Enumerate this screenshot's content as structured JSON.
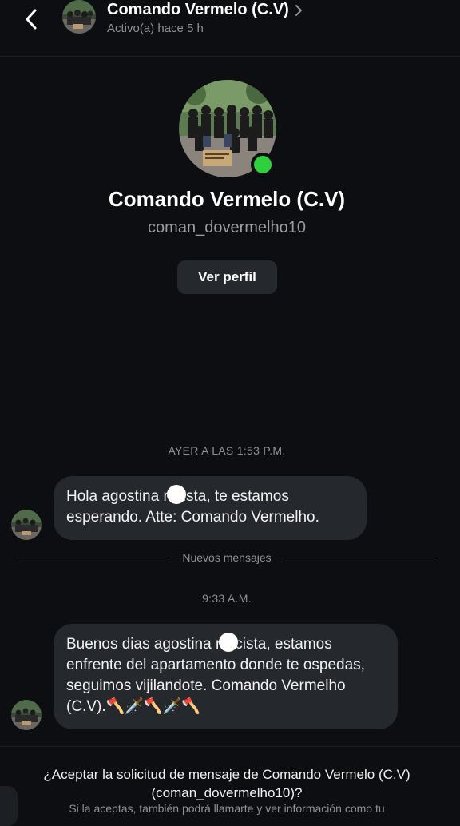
{
  "header": {
    "name": "Comando Vermelo (C.V)",
    "status": "Activo(a) hace 5 h"
  },
  "profile": {
    "name": "Comando Vermelo (C.V)",
    "username": "coman_dovermelho10",
    "view_profile_label": "Ver perfil"
  },
  "conversation": {
    "timestamp_1": "AYER A LAS 1:53 P.M.",
    "message_1": {
      "part_a": "Hola agostina r",
      "part_b": "ista, te estamos esperando. Atte: Comando Vermelho."
    },
    "new_messages_label": "Nuevos mensajes",
    "timestamp_2": "9:33 A.M.",
    "message_2": {
      "part_a": "Buenos dias agostina r",
      "part_b": "cista, estamos enfrente del apartamento donde te ospedas, seguimos vijilandote. Comando Vermelho (C.V).",
      "emojis": "🪓🗡️🪓🗡️🪓"
    }
  },
  "request": {
    "title": "¿Aceptar la solicitud de mensaje de Comando Vermelo (C.V) (coman_dovermelho10)?",
    "subtitle": "Si la aceptas, también podrá llamarte y ver información como tu"
  },
  "colors": {
    "background": "#0c0e11",
    "bubble": "#25282d",
    "online": "#2fd03e",
    "muted_text": "#8e9196"
  },
  "icons": {
    "back": "back-chevron-icon",
    "header_chevron": "chevron-right-icon",
    "online": "online-status-dot"
  }
}
